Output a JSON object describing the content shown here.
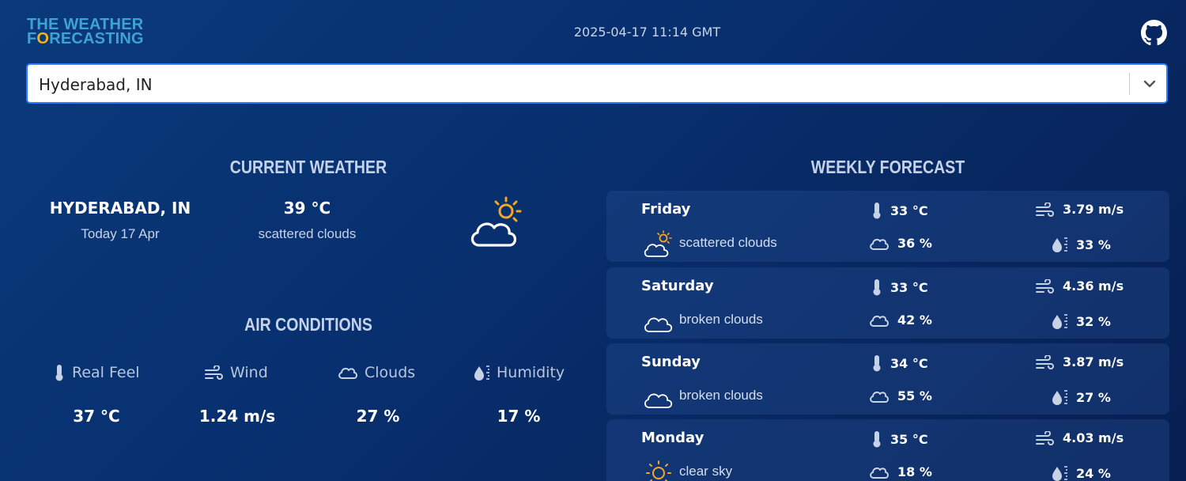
{
  "header": {
    "logo_line1": "THE WEATHER",
    "logo_line2_prefix": "F",
    "logo_line2_o": "O",
    "logo_line2_suffix": "RECASTING",
    "datetime": "2025-04-17 11:14 GMT",
    "github_icon": "github-icon"
  },
  "search": {
    "value": "Hyderabad, IN",
    "dropdown_icon": "chevron-down-icon"
  },
  "current": {
    "title": "CURRENT WEATHER",
    "city": "HYDERABAD, IN",
    "date": "Today 17 Apr",
    "temp": "39 °C",
    "description": "scattered clouds",
    "icon": "partly-cloudy-icon"
  },
  "air": {
    "title": "AIR CONDITIONS",
    "items": [
      {
        "label": "Real Feel",
        "value": "37 °C",
        "icon": "thermometer-icon"
      },
      {
        "label": "Wind",
        "value": "1.24 m/s",
        "icon": "wind-icon"
      },
      {
        "label": "Clouds",
        "value": "27 %",
        "icon": "cloud-icon"
      },
      {
        "label": "Humidity",
        "value": "17 %",
        "icon": "humidity-icon"
      }
    ]
  },
  "weekly": {
    "title": "WEEKLY FORECAST",
    "days": [
      {
        "name": "Friday",
        "icon": "partly-cloudy-icon",
        "desc": "scattered clouds",
        "temp": "33 °C",
        "wind": "3.79 m/s",
        "clouds": "36 %",
        "humidity": "33 %"
      },
      {
        "name": "Saturday",
        "icon": "cloud-icon",
        "desc": "broken clouds",
        "temp": "33 °C",
        "wind": "4.36 m/s",
        "clouds": "42 %",
        "humidity": "32 %"
      },
      {
        "name": "Sunday",
        "icon": "cloud-icon",
        "desc": "broken clouds",
        "temp": "34 °C",
        "wind": "3.87 m/s",
        "clouds": "55 %",
        "humidity": "27 %"
      },
      {
        "name": "Monday",
        "icon": "sun-icon",
        "desc": "clear sky",
        "temp": "35 °C",
        "wind": "4.03 m/s",
        "clouds": "18 %",
        "humidity": "24 %"
      }
    ]
  },
  "colors": {
    "accent_blue": "#2a7fff",
    "logo_blue": "#3fa2d6",
    "logo_orange": "#f0b31a",
    "sun": "#f5a623"
  }
}
